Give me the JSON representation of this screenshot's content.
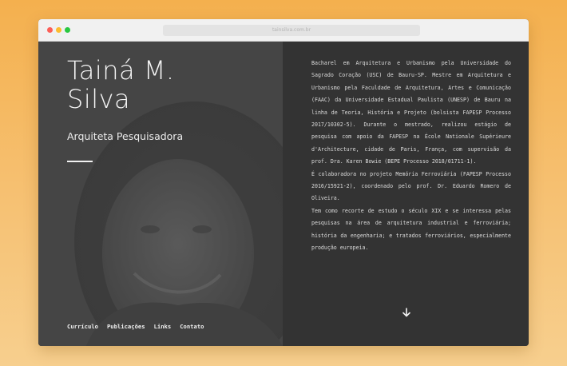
{
  "browser": {
    "url": "tainsilva.com.br"
  },
  "profile": {
    "name": "Tainá M.\nSilva",
    "subtitle": "Arquiteta Pesquisadora"
  },
  "nav": {
    "items": [
      "Currículo",
      "Publicações",
      "Links",
      "Contato"
    ]
  },
  "bio": {
    "paragraphs": [
      "Bacharel em Arquitetura e Urbanismo pela Universidade do Sagrado Coração (USC) de Bauru-SP. Mestre em Arquitetura e Urbanismo pela Faculdade de Arquitetura, Artes e Comunicação (FAAC) da Universidade Estadual Paulista (UNESP) de Bauru na linha de Teoria, História e Projeto (bolsista FAPESP Processo 2017/10302-5). Durante o mestrado, realizou estágio de pesquisa com apoio da FAPESP na École Nationale Supérieure d'Architecture, cidade de Paris, França, com supervisão da prof. Dra. Karen Bowie (BEPE Processo 2018/01711-1).",
      "É colaboradora no projeto Memória Ferroviária (FAPESP Processo 2016/15921-2), coordenado pelo prof. Dr. Eduardo Romero de Oliveira.",
      "Tem como recorte de estudo o século XIX e se interessa pelas pesquisas na área de arquitetura industrial e ferroviária; história da engenharia; e tratados ferroviários, especialmente produção europeia."
    ]
  },
  "icons": {
    "scroll": "arrow-down-icon"
  },
  "colors": {
    "background_top": "#f4b04e",
    "left_panel": "#434343",
    "right_panel": "#333333",
    "text": "#f4f4f4"
  }
}
